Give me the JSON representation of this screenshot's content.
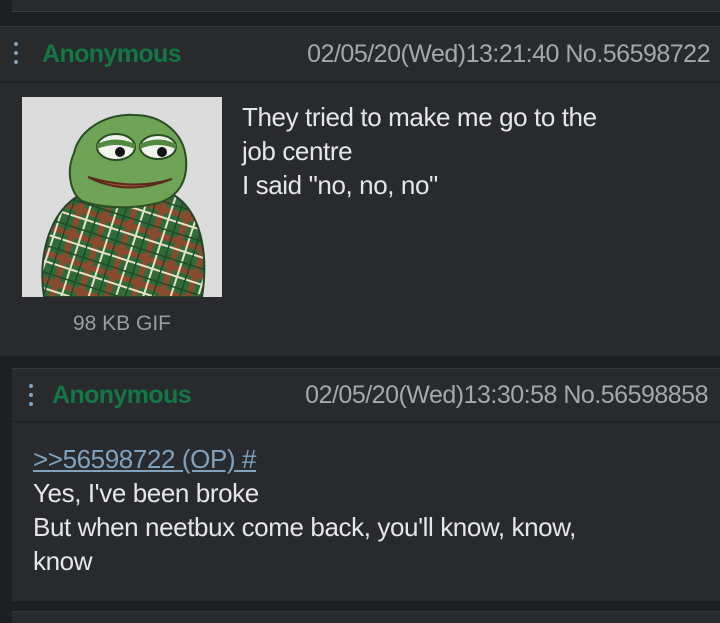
{
  "posts": [
    {
      "name": "Anonymous",
      "datetime": "02/05/20(Wed)13:21:40",
      "post_no": "No.56598722",
      "file": {
        "info": "98 KB GIF",
        "image": "pepe-blanket-thumbnail"
      },
      "lines": [
        "They tried to make me go to the",
        "job centre",
        "I said \"no, no, no\""
      ]
    },
    {
      "name": "Anonymous",
      "datetime": "02/05/20(Wed)13:30:58",
      "post_no": "No.56598858",
      "quotelink": ">>56598722 (OP) #",
      "lines": [
        "Yes, I've been broke",
        "But when neetbux come back, you'll know, know,",
        "know"
      ]
    }
  ],
  "colors": {
    "background": "#1d1f21",
    "post_bg": "#282a2e",
    "name": "#117743",
    "meta": "#a5a8ab",
    "text": "#e5e6e7",
    "link": "#81a2be"
  },
  "icons": {
    "post_menu": "vertical-dots-menu-icon"
  }
}
